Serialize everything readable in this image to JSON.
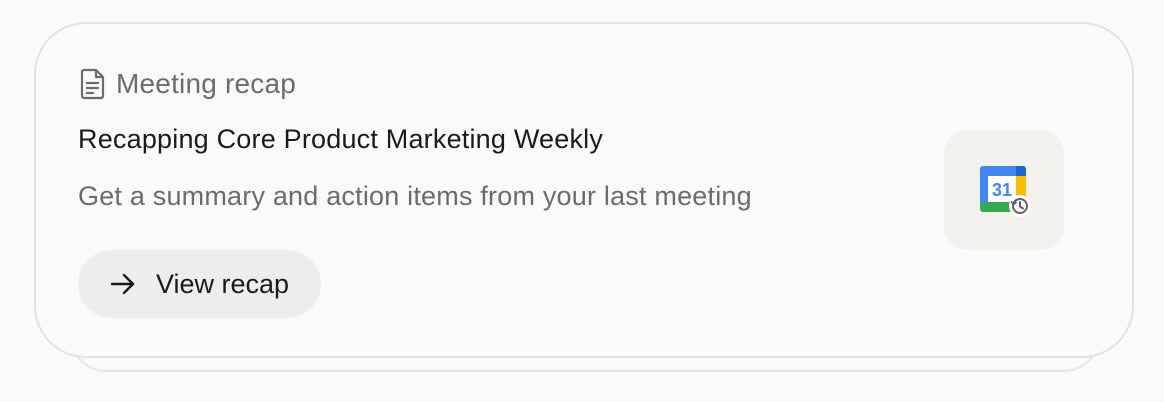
{
  "card": {
    "header_label": "Meeting recap",
    "title": "Recapping Core Product Marketing Weekly",
    "subtitle": "Get a summary and action items from your last meeting",
    "button_label": "View recap",
    "icons": {
      "header": "document-icon",
      "button": "arrow-right-icon",
      "app": "google-calendar-history-icon"
    },
    "calendar_day": "31"
  },
  "colors": {
    "card_background": "#fafafa",
    "card_border": "#e2e2e2",
    "button_background": "#ededed",
    "tile_background": "#f2f1ee",
    "primary_text": "#1a1a1a",
    "secondary_text": "#6b6b6b",
    "calendar_blue": "#4285f4",
    "calendar_green": "#34a853",
    "calendar_yellow": "#fbbc04",
    "calendar_dark_blue": "#1967d2"
  }
}
